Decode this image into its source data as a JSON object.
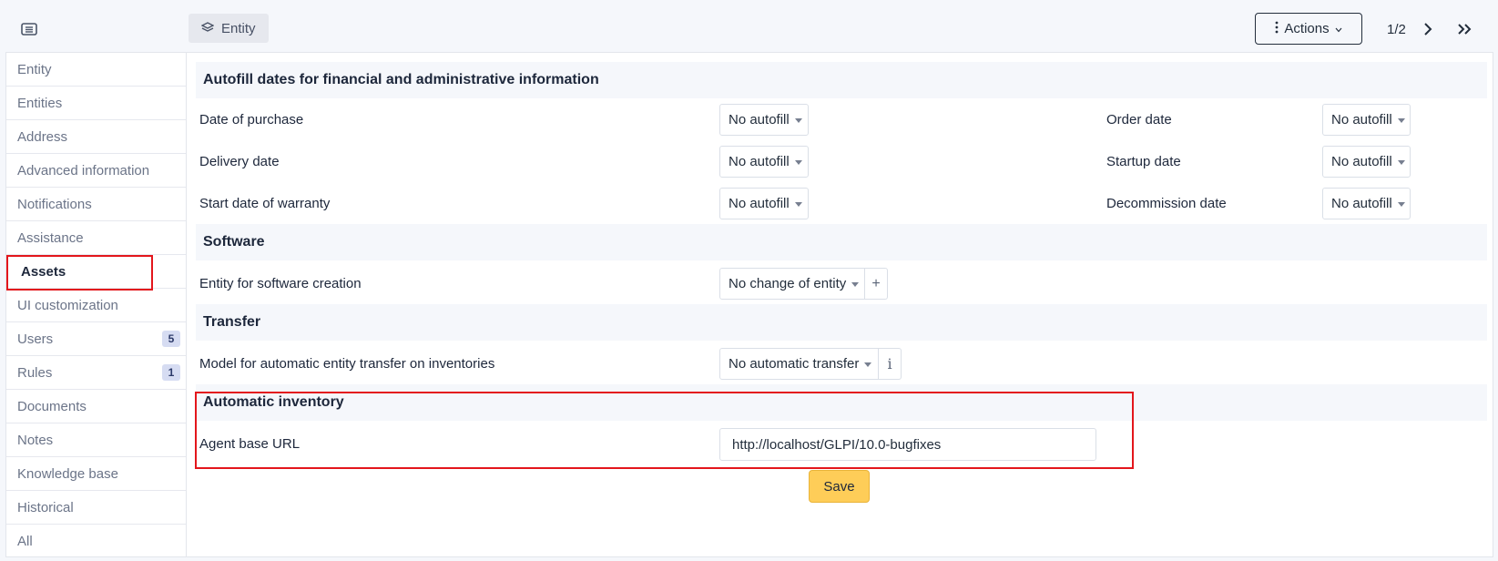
{
  "header": {
    "tab_label": "Entity",
    "actions_label": "Actions",
    "pager": "1/2"
  },
  "sidebar": {
    "items": [
      {
        "label": "Entity"
      },
      {
        "label": "Entities"
      },
      {
        "label": "Address"
      },
      {
        "label": "Advanced information"
      },
      {
        "label": "Notifications"
      },
      {
        "label": "Assistance"
      },
      {
        "label": "Assets",
        "active": true
      },
      {
        "label": "UI customization"
      },
      {
        "label": "Users",
        "badge": "5"
      },
      {
        "label": "Rules",
        "badge": "1"
      },
      {
        "label": "Documents"
      },
      {
        "label": "Notes"
      },
      {
        "label": "Knowledge base"
      },
      {
        "label": "Historical"
      },
      {
        "label": "All"
      }
    ]
  },
  "autofill": {
    "title": "Autofill dates for financial and administrative information",
    "date_of_purchase": {
      "label": "Date of purchase",
      "value": "No autofill"
    },
    "order_date": {
      "label": "Order date",
      "value": "No autofill"
    },
    "delivery_date": {
      "label": "Delivery date",
      "value": "No autofill"
    },
    "startup_date": {
      "label": "Startup date",
      "value": "No autofill"
    },
    "start_warranty": {
      "label": "Start date of warranty",
      "value": "No autofill"
    },
    "decommission_date": {
      "label": "Decommission date",
      "value": "No autofill"
    }
  },
  "software": {
    "title": "Software",
    "entity_label": "Entity for software creation",
    "entity_value": "No change of entity",
    "add_symbol": "+"
  },
  "transfer": {
    "title": "Transfer",
    "model_label": "Model for automatic entity transfer on inventories",
    "model_value": "No automatic transfer",
    "info_symbol": "i"
  },
  "inventory": {
    "title": "Automatic inventory",
    "agent_url_label": "Agent base URL",
    "agent_url_value": "http://localhost/GLPI/10.0-bugfixes"
  },
  "save_label": "Save",
  "colors": {
    "accent_save": "#fecd58",
    "highlight": "#e3161c"
  }
}
